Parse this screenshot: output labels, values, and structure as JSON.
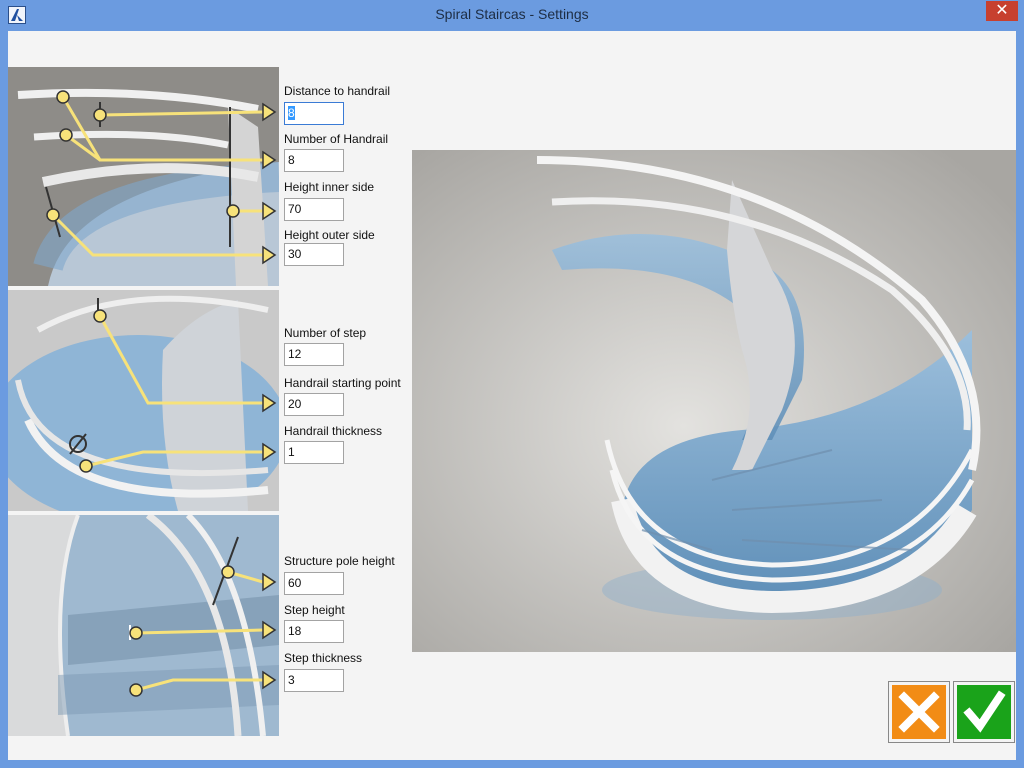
{
  "window": {
    "title": "Spiral Staircas - Settings",
    "close_glyph": "✕",
    "app_icon": "app-logo-icon"
  },
  "fields": {
    "distance_to_handrail": {
      "label": "Distance to handrail",
      "value": "8"
    },
    "number_of_handrail": {
      "label": "Number of Handrail",
      "value": "8"
    },
    "height_inner_side": {
      "label": "Height inner side",
      "value": "70"
    },
    "height_outer_side": {
      "label": "Height outer side",
      "value": "30"
    },
    "number_of_step": {
      "label": "Number of step",
      "value": "12"
    },
    "handrail_starting_point": {
      "label": "Handrail starting point",
      "value": "20"
    },
    "handrail_thickness": {
      "label": "Handrail thickness",
      "value": "1"
    },
    "structure_pole_height": {
      "label": "Structure pole height",
      "value": "60"
    },
    "step_height": {
      "label": "Step height",
      "value": "18"
    },
    "step_thickness": {
      "label": "Step thickness",
      "value": "3"
    }
  },
  "buttons": {
    "cancel_icon": "cross-icon",
    "ok_icon": "checkmark-icon"
  },
  "colors": {
    "titlebar": "#6b9be0",
    "close": "#c7402f",
    "cancel": "#f28c15",
    "ok": "#1aa31a",
    "callout": "#f7e27a",
    "glass": "#8fb5d6"
  }
}
